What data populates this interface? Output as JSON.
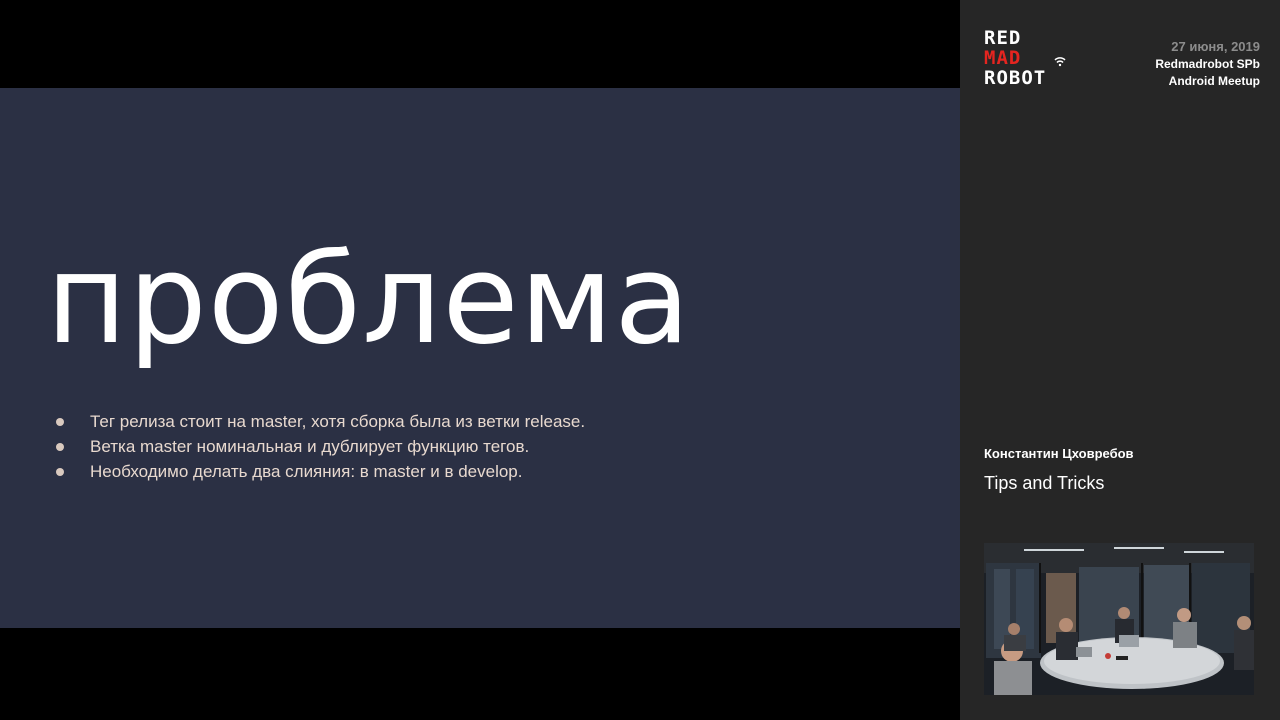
{
  "slide": {
    "title": "проблема",
    "bullets": [
      "Тег релиза стоит на master, хотя сборка была из ветки release.",
      "Ветка master номинальная и дублирует функцию тегов.",
      "Необходимо делать два слияния: в master и в develop."
    ]
  },
  "sidebar": {
    "logo": [
      "RED",
      "MAD",
      "ROBOT"
    ],
    "date": "27 июня, 2019",
    "event_line1": "Redmadrobot SPb",
    "event_line2": "Android Meetup",
    "speaker": "Константин Цховребов",
    "talk_title": "Tips and Tricks"
  },
  "colors": {
    "slide_bg": "#2b3044",
    "side_bg": "#262626",
    "logo_accent": "#e52520",
    "bullet_text": "#e8d9cf"
  }
}
